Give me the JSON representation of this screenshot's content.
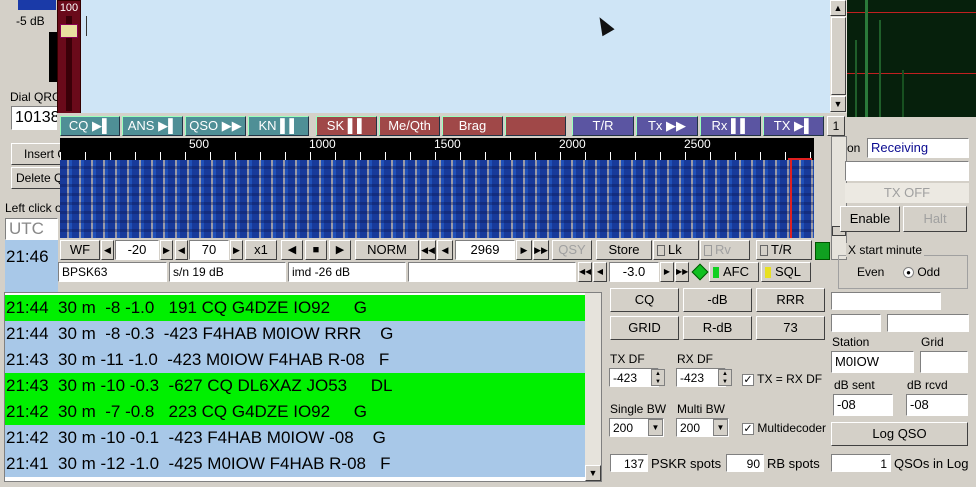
{
  "left": {
    "db_label": "-5 dB",
    "dial_label": "Dial QRG",
    "dial_value": "10138",
    "insert_label": "Insert Q",
    "delete_label": "Delete Q",
    "hint": "Left click o",
    "utc_label": "UTC",
    "utc_row": "21:46"
  },
  "slider": {
    "value": "100"
  },
  "macros": {
    "cq": "CQ",
    "ans": "ANS",
    "qso": "QSO",
    "kn": "KN",
    "sk": "SK",
    "meqth": "Me/Qth",
    "brag": "Brag",
    "blank": "",
    "tr": "T/R",
    "tx": "Tx",
    "rx": "Rx",
    "txend": "TX",
    "num": "1"
  },
  "scale": {
    "ticks": [
      "500",
      "1000",
      "1500",
      "2000",
      "2500"
    ]
  },
  "controls": {
    "wf": "WF",
    "ref": "-20",
    "range": "70",
    "zoom": "x1",
    "norm": "NORM",
    "freq": "2969",
    "qsy": "QSY",
    "store": "Store",
    "lk": "Lk",
    "rv": "Rv",
    "tr": "T/R"
  },
  "status": {
    "mode": "BPSK63",
    "sn": "s/n 19 dB",
    "imd": "imd -26 dB",
    "empty": "",
    "squelch": "-3.0",
    "afc": "AFC",
    "sql": "SQL"
  },
  "decodes": [
    {
      "text": "21:44  30 m  -8 -1.0   191 CQ G4DZE IO92     G",
      "color": "green"
    },
    {
      "text": "21:44  30 m  -8 -0.3  -423 F4HAB M0IOW RRR    G",
      "color": "blue"
    },
    {
      "text": "21:43  30 m -11 -1.0  -423 M0IOW F4HAB R-08   F",
      "color": "blue"
    },
    {
      "text": "21:43  30 m -10 -0.3  -627 CQ DL6XAZ JO53     DL",
      "color": "green"
    },
    {
      "text": "21:42  30 m  -7 -0.8   223 CQ G4DZE IO92     G",
      "color": "green"
    },
    {
      "text": "21:42  30 m -10 -0.1  -423 F4HAB M0IOW -08    G",
      "color": "blue"
    },
    {
      "text": "21:41  30 m -12 -1.0  -425 M0IOW F4HAB R-08   F",
      "color": "blue"
    }
  ],
  "right": {
    "on_label": "on",
    "receiving": "Receiving",
    "tx_off": "TX OFF",
    "enable": "Enable",
    "halt": "Halt",
    "tx_start": "X start minute",
    "even": "Even",
    "odd": "Odd",
    "station_label": "Station",
    "grid_label": "Grid",
    "station_value": "M0IOW",
    "grid_value": "",
    "dbsent_label": "dB sent",
    "dbrcvd_label": "dB rcvd",
    "dbsent_value": "-08",
    "dbrcvd_value": "-08",
    "logqso": "Log QSO",
    "qsos_value": "1",
    "qsos_label": "QSOs in Log"
  },
  "quick": {
    "cq": "CQ",
    "mdb": "-dB",
    "rrr": "RRR",
    "grid": "GRID",
    "rdb": "R-dB",
    "s73": "73"
  },
  "txrx": {
    "txdf_label": "TX DF",
    "rxdf_label": "RX DF",
    "txdf_value": "-423",
    "rxdf_value": "-423",
    "txeqrx": "TX = RX DF",
    "single_label": "Single BW",
    "multi_label": "Multi BW",
    "single_value": "200",
    "multi_value": "200",
    "multidecoder": "Multidecoder",
    "pskr_value": "137",
    "pskr_label": "PSKR spots",
    "rb_value": "90",
    "rb_label": "RB spots"
  },
  "colors": {
    "waterfall_bg": "#1030a0",
    "decode_green": "#00f000",
    "decode_blue": "#a8c8e8",
    "macro_teal": "#4f8f96",
    "macro_red": "#a04848",
    "macro_blue": "#5b55a2"
  }
}
